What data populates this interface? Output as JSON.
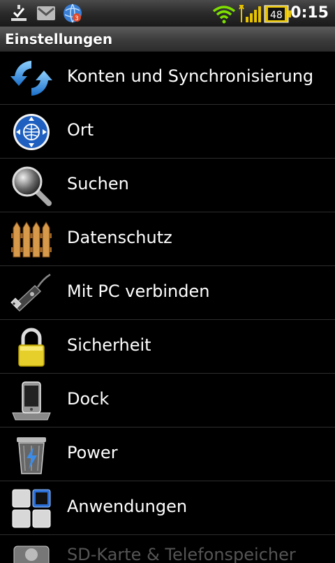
{
  "status_bar": {
    "time": "0:15",
    "battery_level": "48",
    "icons": [
      "download-complete-icon",
      "gmail-icon",
      "browser-icon",
      "wifi-icon",
      "signal-icon",
      "battery-icon"
    ]
  },
  "title_bar": {
    "title": "Einstellungen"
  },
  "settings": {
    "items": [
      {
        "label": "Konten und Synchronisierung",
        "icon": "sync-icon"
      },
      {
        "label": "Ort",
        "icon": "location-icon"
      },
      {
        "label": "Suchen",
        "icon": "search-icon"
      },
      {
        "label": "Datenschutz",
        "icon": "fence-icon"
      },
      {
        "label": "Mit PC verbinden",
        "icon": "usb-icon"
      },
      {
        "label": "Sicherheit",
        "icon": "lock-icon"
      },
      {
        "label": "Dock",
        "icon": "dock-icon"
      },
      {
        "label": "Power",
        "icon": "power-trash-icon"
      },
      {
        "label": "Anwendungen",
        "icon": "applications-icon"
      },
      {
        "label": "SD-Karte & Telefonspeicher",
        "icon": "sd-card-icon"
      }
    ]
  }
}
